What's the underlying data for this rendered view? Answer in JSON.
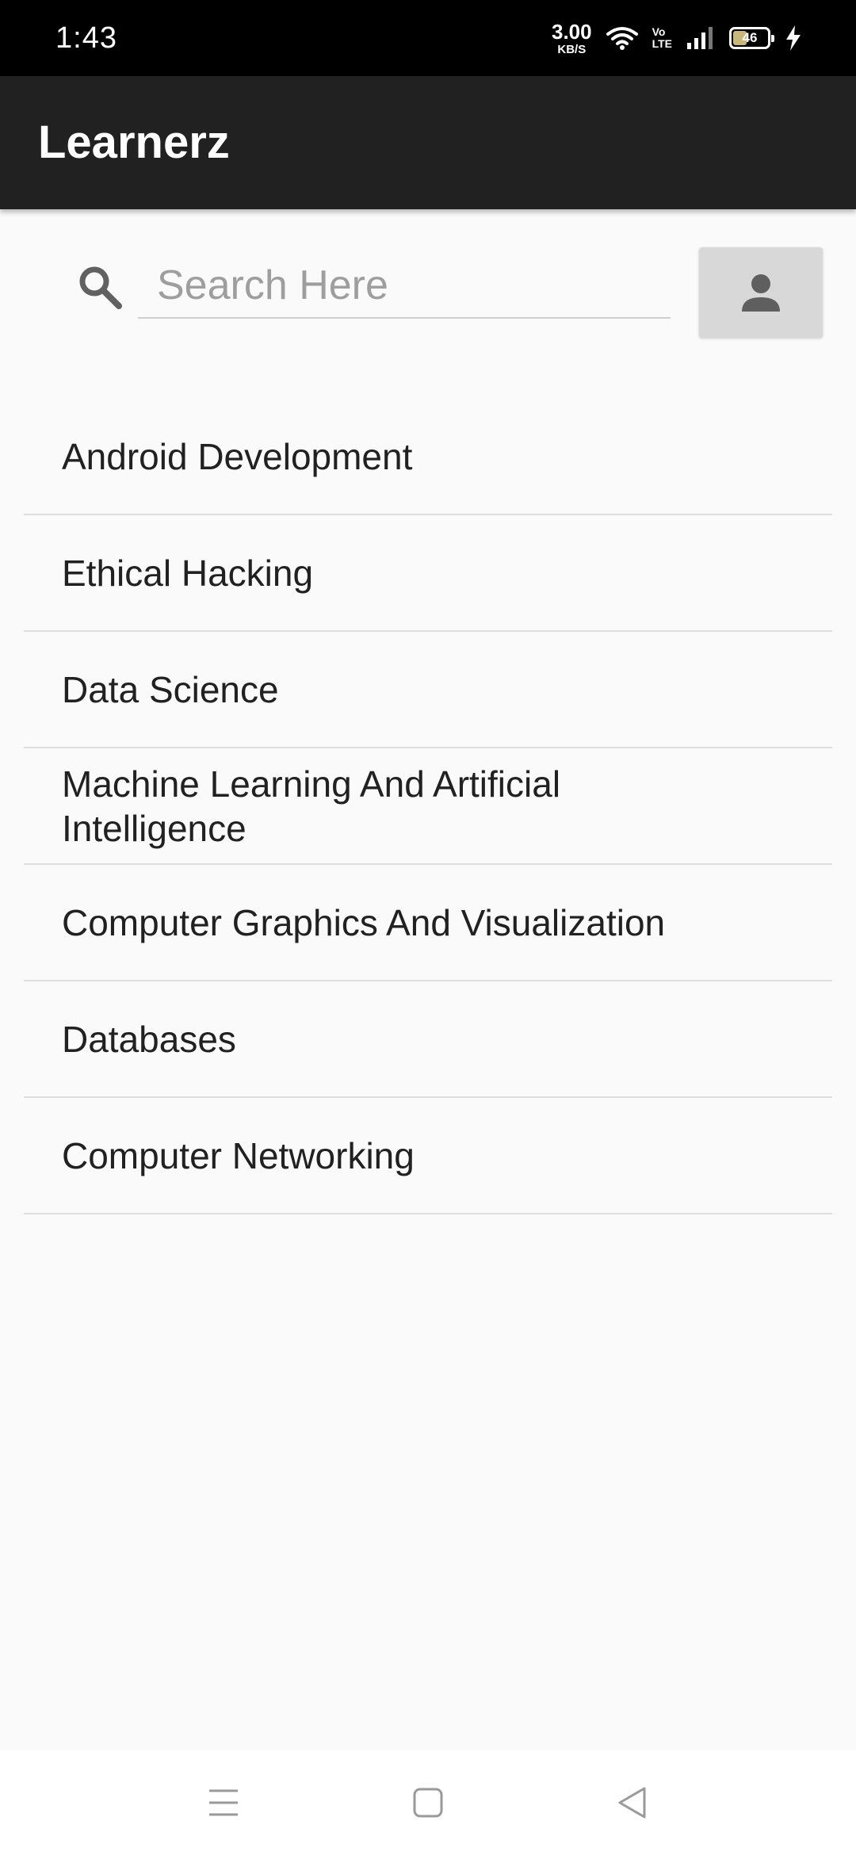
{
  "status_bar": {
    "time": "1:43",
    "net_speed_value": "3.00",
    "net_speed_unit": "KB/S",
    "volte_top": "Vo",
    "volte_bottom": "LTE",
    "battery_level": "46",
    "battery_fraction": 0.46
  },
  "app_bar": {
    "title": "Learnerz"
  },
  "search": {
    "placeholder": "Search Here",
    "value": ""
  },
  "courses": [
    "Android Development",
    "Ethical Hacking",
    "Data Science",
    "Machine Learning And Artificial Intelligence",
    "Computer Graphics And Visualization",
    "Databases",
    "Computer Networking"
  ],
  "icons": {
    "search": "search-icon",
    "profile": "person-icon",
    "wifi": "wifi-icon",
    "signal": "signal-icon",
    "battery": "battery-icon",
    "charging": "lightning-icon",
    "nav_menu": "menu-icon",
    "nav_home": "home-icon",
    "nav_back": "back-icon"
  },
  "colors": {
    "app_bar": "#212121",
    "status_bar": "#000000",
    "background": "#fafafa",
    "profile_button": "#d8d8d8",
    "battery_fill": "#c8b97a"
  }
}
